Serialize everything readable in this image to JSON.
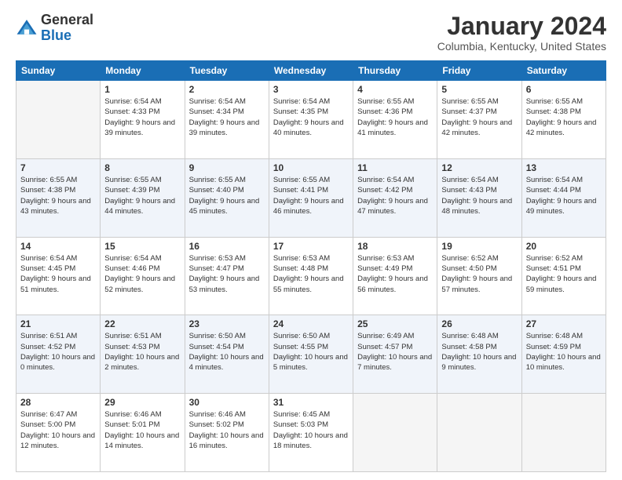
{
  "header": {
    "logo": {
      "general": "General",
      "blue": "Blue"
    },
    "title": "January 2024",
    "subtitle": "Columbia, Kentucky, United States"
  },
  "calendar": {
    "days_of_week": [
      "Sunday",
      "Monday",
      "Tuesday",
      "Wednesday",
      "Thursday",
      "Friday",
      "Saturday"
    ],
    "weeks": [
      [
        {
          "day": "",
          "empty": true
        },
        {
          "day": "1",
          "sunrise": "Sunrise: 6:54 AM",
          "sunset": "Sunset: 4:33 PM",
          "daylight": "Daylight: 9 hours and 39 minutes."
        },
        {
          "day": "2",
          "sunrise": "Sunrise: 6:54 AM",
          "sunset": "Sunset: 4:34 PM",
          "daylight": "Daylight: 9 hours and 39 minutes."
        },
        {
          "day": "3",
          "sunrise": "Sunrise: 6:54 AM",
          "sunset": "Sunset: 4:35 PM",
          "daylight": "Daylight: 9 hours and 40 minutes."
        },
        {
          "day": "4",
          "sunrise": "Sunrise: 6:55 AM",
          "sunset": "Sunset: 4:36 PM",
          "daylight": "Daylight: 9 hours and 41 minutes."
        },
        {
          "day": "5",
          "sunrise": "Sunrise: 6:55 AM",
          "sunset": "Sunset: 4:37 PM",
          "daylight": "Daylight: 9 hours and 42 minutes."
        },
        {
          "day": "6",
          "sunrise": "Sunrise: 6:55 AM",
          "sunset": "Sunset: 4:38 PM",
          "daylight": "Daylight: 9 hours and 42 minutes."
        }
      ],
      [
        {
          "day": "7",
          "sunrise": "Sunrise: 6:55 AM",
          "sunset": "Sunset: 4:38 PM",
          "daylight": "Daylight: 9 hours and 43 minutes."
        },
        {
          "day": "8",
          "sunrise": "Sunrise: 6:55 AM",
          "sunset": "Sunset: 4:39 PM",
          "daylight": "Daylight: 9 hours and 44 minutes."
        },
        {
          "day": "9",
          "sunrise": "Sunrise: 6:55 AM",
          "sunset": "Sunset: 4:40 PM",
          "daylight": "Daylight: 9 hours and 45 minutes."
        },
        {
          "day": "10",
          "sunrise": "Sunrise: 6:55 AM",
          "sunset": "Sunset: 4:41 PM",
          "daylight": "Daylight: 9 hours and 46 minutes."
        },
        {
          "day": "11",
          "sunrise": "Sunrise: 6:54 AM",
          "sunset": "Sunset: 4:42 PM",
          "daylight": "Daylight: 9 hours and 47 minutes."
        },
        {
          "day": "12",
          "sunrise": "Sunrise: 6:54 AM",
          "sunset": "Sunset: 4:43 PM",
          "daylight": "Daylight: 9 hours and 48 minutes."
        },
        {
          "day": "13",
          "sunrise": "Sunrise: 6:54 AM",
          "sunset": "Sunset: 4:44 PM",
          "daylight": "Daylight: 9 hours and 49 minutes."
        }
      ],
      [
        {
          "day": "14",
          "sunrise": "Sunrise: 6:54 AM",
          "sunset": "Sunset: 4:45 PM",
          "daylight": "Daylight: 9 hours and 51 minutes."
        },
        {
          "day": "15",
          "sunrise": "Sunrise: 6:54 AM",
          "sunset": "Sunset: 4:46 PM",
          "daylight": "Daylight: 9 hours and 52 minutes."
        },
        {
          "day": "16",
          "sunrise": "Sunrise: 6:53 AM",
          "sunset": "Sunset: 4:47 PM",
          "daylight": "Daylight: 9 hours and 53 minutes."
        },
        {
          "day": "17",
          "sunrise": "Sunrise: 6:53 AM",
          "sunset": "Sunset: 4:48 PM",
          "daylight": "Daylight: 9 hours and 55 minutes."
        },
        {
          "day": "18",
          "sunrise": "Sunrise: 6:53 AM",
          "sunset": "Sunset: 4:49 PM",
          "daylight": "Daylight: 9 hours and 56 minutes."
        },
        {
          "day": "19",
          "sunrise": "Sunrise: 6:52 AM",
          "sunset": "Sunset: 4:50 PM",
          "daylight": "Daylight: 9 hours and 57 minutes."
        },
        {
          "day": "20",
          "sunrise": "Sunrise: 6:52 AM",
          "sunset": "Sunset: 4:51 PM",
          "daylight": "Daylight: 9 hours and 59 minutes."
        }
      ],
      [
        {
          "day": "21",
          "sunrise": "Sunrise: 6:51 AM",
          "sunset": "Sunset: 4:52 PM",
          "daylight": "Daylight: 10 hours and 0 minutes."
        },
        {
          "day": "22",
          "sunrise": "Sunrise: 6:51 AM",
          "sunset": "Sunset: 4:53 PM",
          "daylight": "Daylight: 10 hours and 2 minutes."
        },
        {
          "day": "23",
          "sunrise": "Sunrise: 6:50 AM",
          "sunset": "Sunset: 4:54 PM",
          "daylight": "Daylight: 10 hours and 4 minutes."
        },
        {
          "day": "24",
          "sunrise": "Sunrise: 6:50 AM",
          "sunset": "Sunset: 4:55 PM",
          "daylight": "Daylight: 10 hours and 5 minutes."
        },
        {
          "day": "25",
          "sunrise": "Sunrise: 6:49 AM",
          "sunset": "Sunset: 4:57 PM",
          "daylight": "Daylight: 10 hours and 7 minutes."
        },
        {
          "day": "26",
          "sunrise": "Sunrise: 6:48 AM",
          "sunset": "Sunset: 4:58 PM",
          "daylight": "Daylight: 10 hours and 9 minutes."
        },
        {
          "day": "27",
          "sunrise": "Sunrise: 6:48 AM",
          "sunset": "Sunset: 4:59 PM",
          "daylight": "Daylight: 10 hours and 10 minutes."
        }
      ],
      [
        {
          "day": "28",
          "sunrise": "Sunrise: 6:47 AM",
          "sunset": "Sunset: 5:00 PM",
          "daylight": "Daylight: 10 hours and 12 minutes."
        },
        {
          "day": "29",
          "sunrise": "Sunrise: 6:46 AM",
          "sunset": "Sunset: 5:01 PM",
          "daylight": "Daylight: 10 hours and 14 minutes."
        },
        {
          "day": "30",
          "sunrise": "Sunrise: 6:46 AM",
          "sunset": "Sunset: 5:02 PM",
          "daylight": "Daylight: 10 hours and 16 minutes."
        },
        {
          "day": "31",
          "sunrise": "Sunrise: 6:45 AM",
          "sunset": "Sunset: 5:03 PM",
          "daylight": "Daylight: 10 hours and 18 minutes."
        },
        {
          "day": "",
          "empty": true
        },
        {
          "day": "",
          "empty": true
        },
        {
          "day": "",
          "empty": true
        }
      ]
    ]
  }
}
